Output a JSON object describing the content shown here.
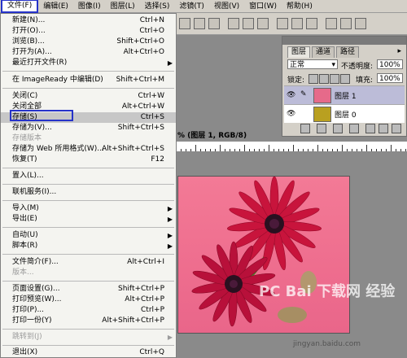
{
  "menubar": {
    "items": [
      "文件(F)",
      "编辑(E)",
      "图像(I)",
      "图层(L)",
      "选择(S)",
      "滤镜(T)",
      "视图(V)",
      "窗口(W)",
      "帮助(H)"
    ]
  },
  "file_menu": {
    "items": [
      {
        "label": "新建(N)...",
        "shortcut": "Ctrl+N"
      },
      {
        "label": "打开(O)...",
        "shortcut": "Ctrl+O"
      },
      {
        "label": "浏览(B)...",
        "shortcut": "Shift+Ctrl+O"
      },
      {
        "label": "打开为(A)...",
        "shortcut": "Alt+Ctrl+O"
      },
      {
        "label": "最近打开文件(R)",
        "shortcut": ""
      },
      {
        "label": "在 ImageReady 中编辑(D)",
        "shortcut": "Shift+Ctrl+M"
      },
      {
        "label": "关闭(C)",
        "shortcut": "Ctrl+W"
      },
      {
        "label": "关闭全部",
        "shortcut": "Alt+Ctrl+W"
      },
      {
        "label": "存储(S)",
        "shortcut": "Ctrl+S"
      },
      {
        "label": "存储为(V)...",
        "shortcut": "Shift+Ctrl+S"
      },
      {
        "label": "存储版本",
        "shortcut": ""
      },
      {
        "label": "存储为 Web 所用格式(W)...",
        "shortcut": "Alt+Shift+Ctrl+S"
      },
      {
        "label": "恢复(T)",
        "shortcut": "F12"
      },
      {
        "label": "置入(L)...",
        "shortcut": ""
      },
      {
        "label": "联机服务(I)...",
        "shortcut": ""
      },
      {
        "label": "导入(M)",
        "shortcut": ""
      },
      {
        "label": "导出(E)",
        "shortcut": ""
      },
      {
        "label": "自动(U)",
        "shortcut": ""
      },
      {
        "label": "脚本(R)",
        "shortcut": ""
      },
      {
        "label": "文件简介(F)...",
        "shortcut": "Alt+Ctrl+I"
      },
      {
        "label": "版本...",
        "shortcut": ""
      },
      {
        "label": "页面设置(G)...",
        "shortcut": "Shift+Ctrl+P"
      },
      {
        "label": "打印预览(W)...",
        "shortcut": "Alt+Ctrl+P"
      },
      {
        "label": "打印(P)...",
        "shortcut": "Ctrl+P"
      },
      {
        "label": "打印一份(Y)",
        "shortcut": "Alt+Shift+Ctrl+P"
      },
      {
        "label": "跳转到(J)",
        "shortcut": ""
      },
      {
        "label": "退出(X)",
        "shortcut": "Ctrl+Q"
      }
    ]
  },
  "document": {
    "title": "% (图层 1, RGB/8)"
  },
  "layers_panel": {
    "tabs": [
      "图层",
      "通道",
      "路径"
    ],
    "blend_mode": "正常",
    "opacity_label": "不透明度:",
    "opacity_value": "100%",
    "lock_label": "锁定:",
    "fill_label": "填充:",
    "fill_value": "100%",
    "layers": [
      {
        "name": "图层 1"
      },
      {
        "name": "图层 0"
      }
    ]
  },
  "watermark": {
    "text": "PC Bai 下载网 经验",
    "url": "jingyan.baidu.com"
  },
  "colors": {
    "menu_bg": "#f4f4f0",
    "highlight_box": "#2633c9",
    "photo_pink": "#f37a96",
    "petal": "#c8143c"
  }
}
